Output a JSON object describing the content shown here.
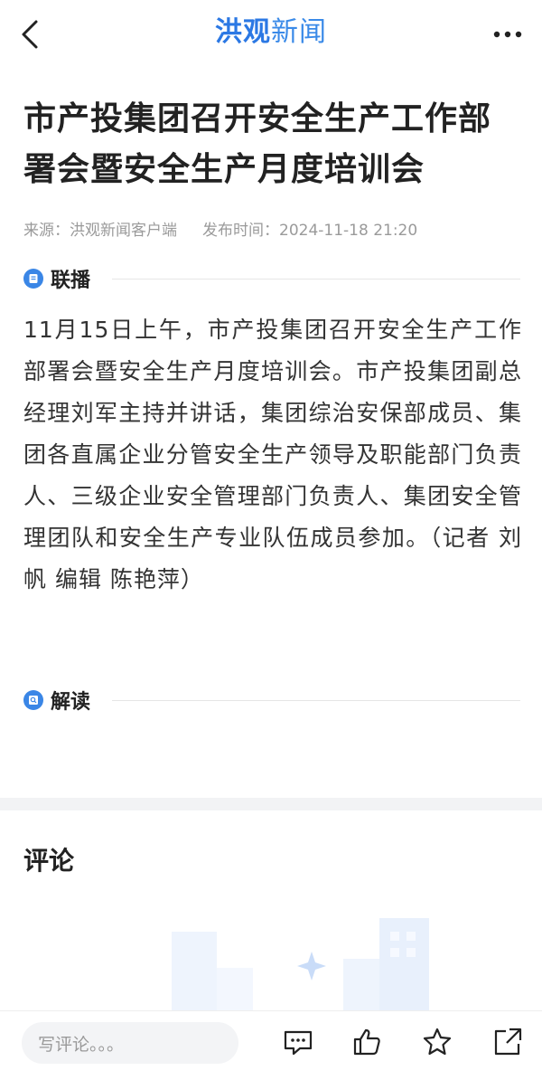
{
  "header": {
    "logo_part1": "洪观",
    "logo_part2": "新闻",
    "back_icon": "chevron-left-icon",
    "more_icon": "more-dots-icon"
  },
  "article": {
    "title": "市产投集团召开安全生产工作部署会暨安全生产月度培训会",
    "source": "来源：洪观新闻客户端",
    "publish_time": "发布时间：2024-11-18 21:20",
    "sections": {
      "lianbo": {
        "label": "联播",
        "text": "11月15日上午，市产投集团召开安全生产工作部署会暨安全生产月度培训会。市产投集团副总经理刘军主持并讲话，集团综治安保部成员、集团各直属企业分管安全生产领导及职能部门负责人、三级企业安全管理部门负责人、集团安全管理团队和安全生产专业队伍成员参加。（记者 刘帆 编辑 陈艳萍）"
      },
      "jiedu": {
        "label": "解读"
      }
    }
  },
  "comments": {
    "title": "评论",
    "input_placeholder": "写评论。。。"
  },
  "bottom_bar": {
    "icons": [
      "comment-icon",
      "like-icon",
      "star-icon",
      "share-icon"
    ]
  },
  "colors": {
    "accent": "#3a86e6",
    "logo_blue": "#2b78e4",
    "meta_gray": "#9a9a9a"
  }
}
